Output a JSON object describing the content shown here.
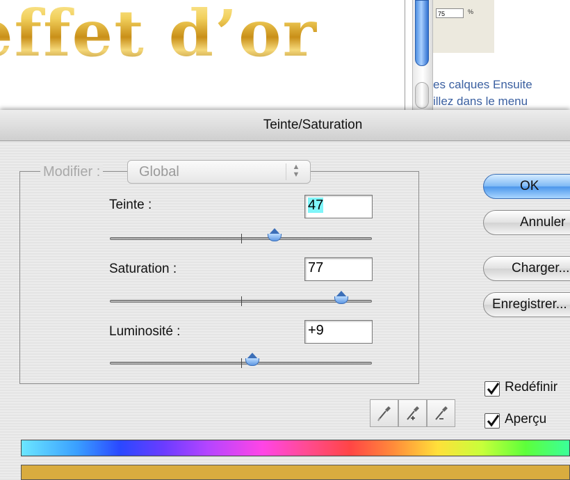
{
  "background": {
    "title_text": "effet d’or",
    "side_field_value": "75",
    "side_field_unit": "%",
    "side_text_line1": "es calques Ensuite",
    "side_text_line2": "illez dans le menu"
  },
  "dialog": {
    "title": "Teinte/Saturation",
    "modifier_label": "Modifier :",
    "modifier_value": "Global",
    "sliders": [
      {
        "label": "Teinte :",
        "value": "47",
        "min": -180,
        "max": 180,
        "numeric": 47
      },
      {
        "label": "Saturation :",
        "value": "77",
        "min": -100,
        "max": 100,
        "numeric": 77
      },
      {
        "label": "Luminosité :",
        "value": "+9",
        "min": -100,
        "max": 100,
        "numeric": 9
      }
    ],
    "buttons": {
      "ok": "OK",
      "cancel": "Annuler",
      "load": "Charger...",
      "save": "Enregistrer..."
    },
    "checkboxes": [
      {
        "label": "Redéfinir",
        "checked": true
      },
      {
        "label": "Aperçu",
        "checked": true
      }
    ],
    "tools": [
      "eyedropper-icon",
      "eyedropper-plus-icon",
      "eyedropper-minus-icon"
    ],
    "result_color": "#d9ac3f"
  }
}
